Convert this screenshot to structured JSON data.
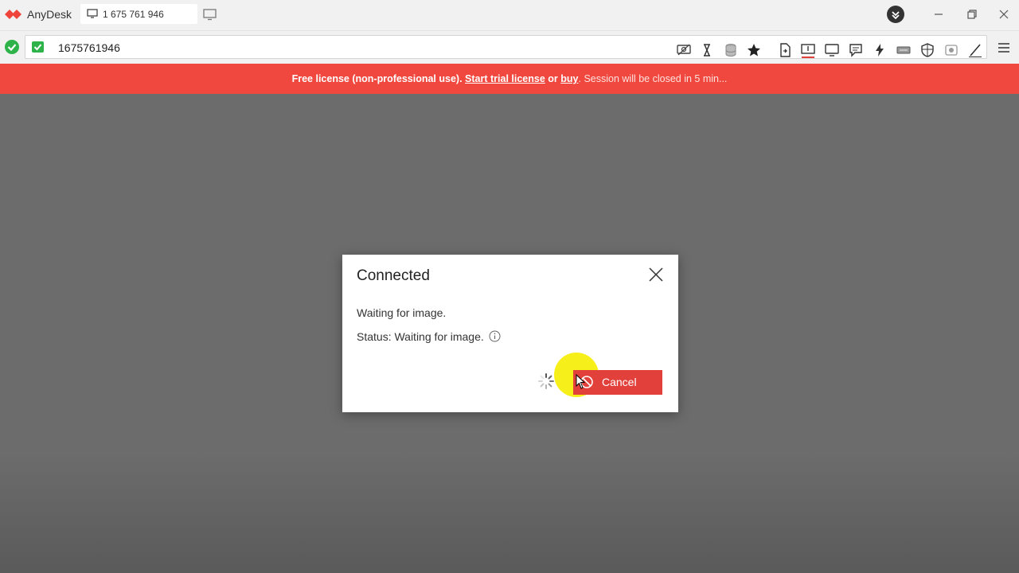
{
  "app": {
    "name": "AnyDesk"
  },
  "tab": {
    "label": "1 675 761 946"
  },
  "address": {
    "value": "1675761946"
  },
  "banner": {
    "prefix": "Free license (non-professional use).",
    "trial_link": "Start trial license",
    "or": "or",
    "buy_link": "buy",
    "suffix": ". Session will be closed in 5 min..."
  },
  "dialog": {
    "title": "Connected",
    "message": "Waiting for image.",
    "status": "Status: Waiting for image.",
    "cancel_label": "Cancel"
  },
  "colors": {
    "accent": "#f0483e",
    "button": "#e2403a",
    "ok": "#2db34a",
    "highlight": "#f7ef1a"
  },
  "icons": [
    "anydesk-logo-icon",
    "monitor-icon",
    "new-tab-icon",
    "download-icon",
    "minimize-icon",
    "restore-icon",
    "close-icon",
    "connected-check-icon",
    "verified-icon",
    "display-settings-icon",
    "hourglass-icon",
    "database-icon",
    "star-icon",
    "file-transfer-icon",
    "monitor-switch-icon",
    "chat-icon",
    "message-icon",
    "lightning-icon",
    "keyboard-icon",
    "shield-icon",
    "record-icon",
    "pen-icon",
    "hamburger-menu-icon",
    "info-icon",
    "spinner-icon"
  ]
}
